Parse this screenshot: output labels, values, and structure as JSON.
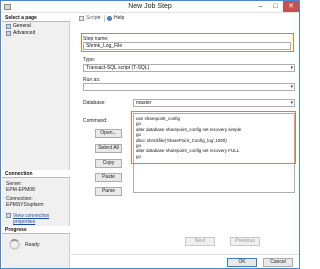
{
  "window": {
    "title": "New Job Step",
    "minimize": "–",
    "maximize": "□",
    "close": "✕"
  },
  "sidebar": {
    "select_page_header": "Select a page",
    "pages": [
      {
        "label": "General",
        "icon": "page-icon"
      },
      {
        "label": "Advanced",
        "icon": "page-icon"
      }
    ],
    "connection_header": "Connection",
    "server_label": "Server:",
    "server_value": "EPM-EPM08",
    "connection_label": "Connection:",
    "connection_value": "EPMSYS\\spfarm",
    "view_connection_properties": "View connection properties",
    "progress_header": "Progress",
    "progress_status": "Ready"
  },
  "toolbar": {
    "script_label": "Script",
    "dropdown_arrow": "▾",
    "help_label": "Help"
  },
  "form": {
    "step_name_label": "Step name:",
    "step_name_value": "Shrink_Log_File",
    "type_label": "Type:",
    "type_value": "Transact-SQL script (T-SQL)",
    "run_as_label": "Run as:",
    "run_as_value": "",
    "database_label": "Database:",
    "database_value": "master",
    "command_label": "Command:",
    "command_lines": [
      "use sharepoint_config",
      "go",
      "alter database sharepoint_config  set recovery simple",
      "go",
      "dbcc shrinkfile('SharePoint_Config_log',1000)",
      "go",
      "alter database sharepoint_config set recovery FULL",
      "go"
    ],
    "buttons": {
      "open": "Open...",
      "select_all": "Select All",
      "copy": "Copy",
      "paste": "Paste",
      "parse": "Parse"
    }
  },
  "footer": {
    "next": "Next",
    "previous": "Previous",
    "ok": "OK",
    "cancel": "Cancel"
  },
  "colors": {
    "highlight": "#ef7c22",
    "window_border": "#4a88c9",
    "link": "#1a4e9a"
  }
}
